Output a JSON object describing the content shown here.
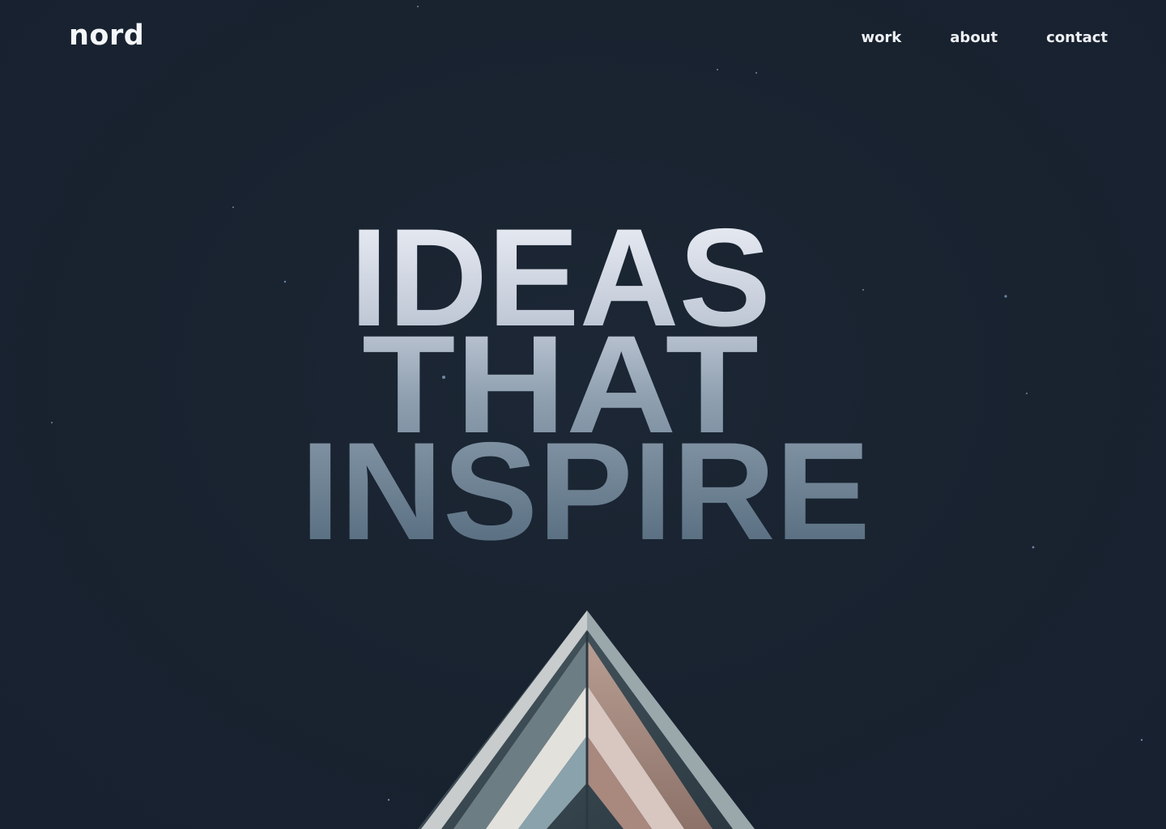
{
  "header": {
    "logo": "nord",
    "nav": [
      {
        "label": "work"
      },
      {
        "label": "about"
      },
      {
        "label": "contact"
      }
    ]
  },
  "hero": {
    "lines": [
      "IDEAS",
      "THAT",
      "INSPIRE"
    ]
  },
  "colors": {
    "background": "#19222f",
    "text_top": "#e6e9f1",
    "text_bottom": "#5d7485",
    "nav_text": "#eef1f5"
  }
}
